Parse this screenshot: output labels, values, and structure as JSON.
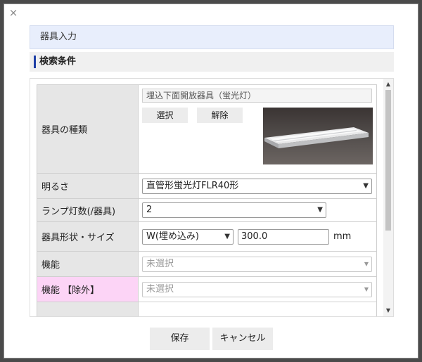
{
  "dialog": {
    "close_glyph": "×",
    "title": "器具入力",
    "section_title": "検索条件"
  },
  "form": {
    "kind": {
      "label": "器具の種類",
      "value": "埋込下面開放器具（蛍光灯）",
      "select_button": "選択",
      "clear_button": "解除",
      "image_icon": "fluorescent-fixture-photo"
    },
    "brightness": {
      "label": "明るさ",
      "value": "直管形蛍光灯FLR40形"
    },
    "lamps": {
      "label": "ランプ灯数(/器具)",
      "value": "2"
    },
    "shape": {
      "label": "器具形状・サイズ",
      "type_value": "W(埋め込み)",
      "size_value": "300.0",
      "unit": "mm"
    },
    "function": {
      "label": "機能",
      "placeholder": "未選択"
    },
    "function_exclude": {
      "label": "機能 【除外】",
      "placeholder": "未選択"
    }
  },
  "footer": {
    "save_label": "保存",
    "cancel_label": "キャンセル"
  },
  "colors": {
    "accent": "#1f3fa6",
    "exclude_row": "#fcd4f6",
    "title_bg": "#e8eefc"
  }
}
